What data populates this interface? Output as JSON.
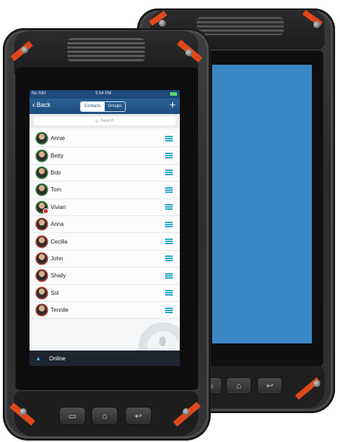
{
  "status_bar": {
    "carrier": "No SIM",
    "time": "5:54 PM"
  },
  "nav": {
    "back_label": "Back",
    "tabs": [
      {
        "label": "Contacts",
        "active": true
      },
      {
        "label": "Groups",
        "active": false
      }
    ],
    "add_symbol": "+"
  },
  "search": {
    "placeholder": "Search"
  },
  "contacts": [
    {
      "name": "Annie",
      "status": "online"
    },
    {
      "name": "Betty",
      "status": "online"
    },
    {
      "name": "Bob",
      "status": "online"
    },
    {
      "name": "Tom",
      "status": "online"
    },
    {
      "name": "Vivian",
      "status": "online"
    },
    {
      "name": "Anna",
      "status": "offline"
    },
    {
      "name": "Cecilia",
      "status": "offline"
    },
    {
      "name": "John",
      "status": "offline"
    },
    {
      "name": "Shaily",
      "status": "offline"
    },
    {
      "name": "Sol",
      "status": "offline"
    },
    {
      "name": "Tennile",
      "status": "offline"
    }
  ],
  "footer": {
    "status_label": "Online"
  },
  "colors": {
    "nav_blue": "#1f4d7e",
    "accent_teal": "#2ba8c9",
    "rear_screen": "#3a87c6",
    "rugged_orange": "#e0481c"
  },
  "icons": {
    "back": "chevron-left-icon",
    "add": "plus-icon",
    "search": "search-icon",
    "row_menu": "hamburger-icon",
    "footer": "person-icon",
    "ptt": "microphone-icon"
  },
  "hardware_buttons": [
    "menu-icon",
    "home-icon",
    "back-arrow-icon"
  ]
}
